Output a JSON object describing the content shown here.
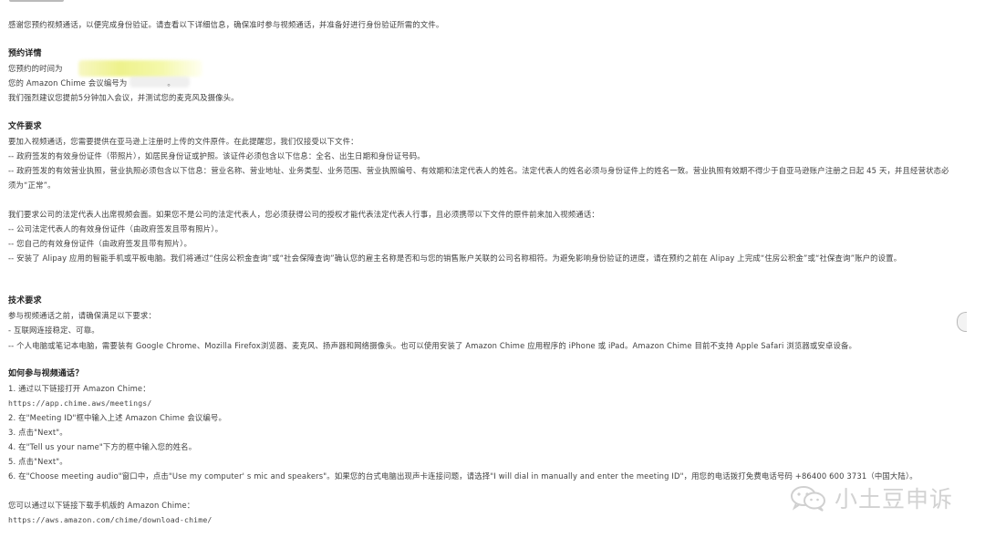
{
  "intro": "感谢您预约视频通话，以便完成身份验证。请查看以下详细信息，确保准时参与视频通话，并准备好进行身份验证所需的文件。",
  "appointment": {
    "title": "预约详情",
    "time_label": "您预约的时间为",
    "meeting_id_label": "您的 Amazon Chime 会议编号为",
    "meeting_id_trailing": "。",
    "advice": "我们强烈建议您提前5分钟加入会议，并测试您的麦克风及摄像头。"
  },
  "documents": {
    "title": "文件要求",
    "line1": "要加入视频通话，您需要提供在亚马逊上注册时上传的文件原件。在此提醒您，我们仅接受以下文件：",
    "line2": "-- 政府签发的有效身份证件（带照片），如居民身份证或护照。该证件必须包含以下信息：全名、出生日期和身份证号码。",
    "line3": "-- 政府签发的有效营业执照，营业执照必须包含以下信息：营业名称、营业地址、业务类型、业务范围、营业执照编号、有效期和法定代表人的姓名。法定代表人的姓名必须与身份证件上的姓名一致。营业执照有效期不得少于自亚马逊账户注册之日起 45 天，并且经营状态必须为“正常”。",
    "rep_line1": "我们要求公司的法定代表人出席视频会面。如果您不是公司的法定代表人，您必须获得公司的授权才能代表法定代表人行事，且必须携带以下文件的原件前来加入视频通话：",
    "rep_line2": "-- 公司法定代表人的有效身份证件（由政府签发且带有照片）。",
    "rep_line3": "-- 您自己的有效身份证件（由政府签发且带有照片）。",
    "rep_line4": "-- 安装了 Alipay 应用的智能手机或平板电脑。我们将通过“住房公积金查询”或“社会保障查询”确认您的雇主名称是否和与您的销售账户关联的公司名称相符。为避免影响身份验证的进度，请在预约之前在 Alipay 上完成“住房公积金”或“社保查询”账户的设置。"
  },
  "tech": {
    "title": "技术要求",
    "line1": "参与视频通话之前，请确保满足以下要求：",
    "line2": "- 互联网连接稳定、可靠。",
    "line3": "-- 个人电脑或笔记本电脑，需要装有 Google Chrome、Mozilla Firefox浏览器、麦克风、扬声器和网络摄像头。也可以使用安装了 Amazon Chime 应用程序的 iPhone 或 iPad。Amazon Chime 目前不支持 Apple Safari 浏览器或安卓设备。"
  },
  "join": {
    "title": "如何参与视频通话？",
    "step1": "1. 通过以下链接打开 Amazon Chime：",
    "url1": "https://app.chime.aws/meetings/",
    "step2": "2. 在\"Meeting ID\"框中输入上述 Amazon Chime 会议编号。",
    "step3": "3. 点击\"Next\"。",
    "step4": "4. 在\"Tell us your name\"下方的框中输入您的姓名。",
    "step5": "5. 点击\"Next\"。",
    "step6": "6. 在\"Choose meeting audio\"窗口中，点击\"Use my computer' s mic and speakers\"。如果您的台式电脑出现声卡连接问题，请选择\"I will dial in manually and enter the meeting ID\"，用您的电话拨打免费电话号码 +86400 600 3731（中国大陆）。",
    "mobile": "您可以通过以下链接下载手机版的 Amazon Chime：",
    "url2": "https://aws.amazon.com/chime/download-chime/"
  },
  "watermark": {
    "icon": "wechat-icon",
    "text": "小土豆申诉"
  }
}
